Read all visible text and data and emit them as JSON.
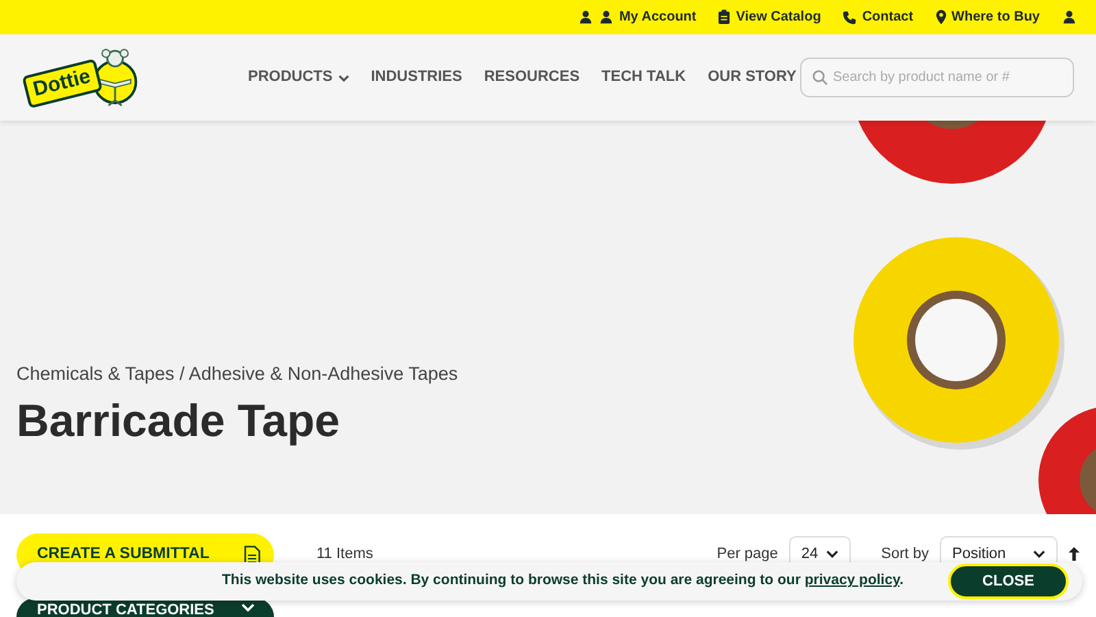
{
  "top_links": [
    {
      "kind": "account",
      "label": "My Account"
    },
    {
      "kind": "catalog",
      "label": "View Catalog"
    },
    {
      "kind": "contact",
      "label": "Contact"
    },
    {
      "kind": "location",
      "label": "Where to Buy"
    }
  ],
  "logo": {
    "text": "Dottie"
  },
  "nav": [
    {
      "label": "PRODUCTS",
      "dropdown": true
    },
    {
      "label": "INDUSTRIES",
      "dropdown": false
    },
    {
      "label": "RESOURCES",
      "dropdown": false
    },
    {
      "label": "TECH TALK",
      "dropdown": false
    },
    {
      "label": "OUR STORY",
      "dropdown": false
    }
  ],
  "search": {
    "placeholder": "Search by product name or #"
  },
  "hero": {
    "breadcrumb": "Chemicals & Tapes / Adhesive & Non-Adhesive Tapes",
    "title": "Barricade Tape",
    "kind": "picture"
  },
  "toolbar": {
    "submittal": "CREATE A SUBMITTAL",
    "count": "11 Items",
    "per_page_label": "Per page",
    "per_page": "24",
    "sort_label": "Sort by",
    "sort": "Position"
  },
  "categories": {
    "label": "PRODUCT CATEGORIES",
    "expanded": false
  },
  "cookie": {
    "text": "This website uses cookies. By continuing to browse this site you are agreeing to our",
    "link": "privacy policy",
    "end": ".",
    "button": "CLOSE"
  }
}
